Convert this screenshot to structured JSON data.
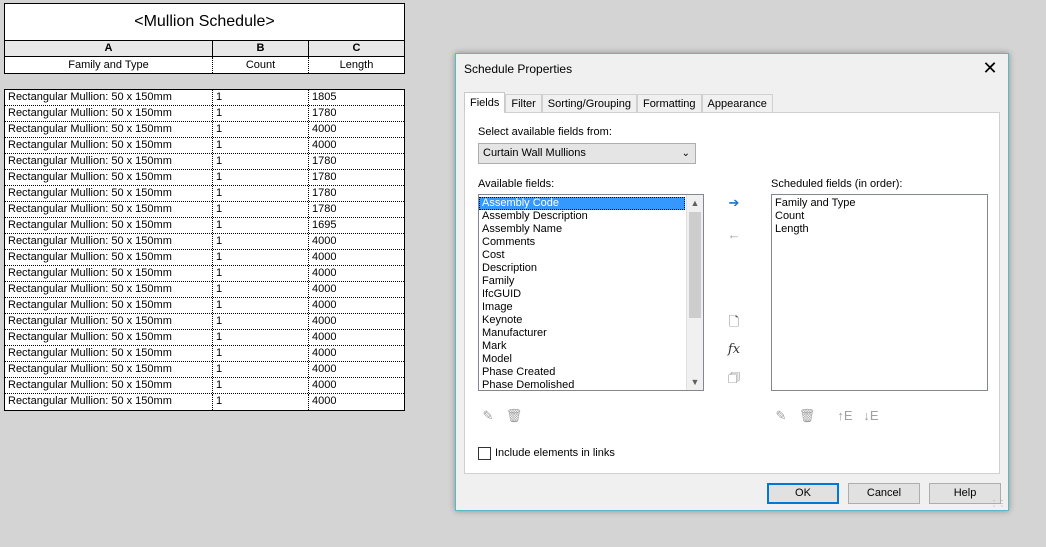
{
  "schedule": {
    "title": "<Mullion Schedule>",
    "column_letters": [
      "A",
      "B",
      "C"
    ],
    "column_headers": [
      "Family and Type",
      "Count",
      "Length"
    ],
    "rows": [
      [
        "Rectangular Mullion: 50 x 150mm",
        "1",
        "1805"
      ],
      [
        "Rectangular Mullion: 50 x 150mm",
        "1",
        "1780"
      ],
      [
        "Rectangular Mullion: 50 x 150mm",
        "1",
        "4000"
      ],
      [
        "Rectangular Mullion: 50 x 150mm",
        "1",
        "4000"
      ],
      [
        "Rectangular Mullion: 50 x 150mm",
        "1",
        "1780"
      ],
      [
        "Rectangular Mullion: 50 x 150mm",
        "1",
        "1780"
      ],
      [
        "Rectangular Mullion: 50 x 150mm",
        "1",
        "1780"
      ],
      [
        "Rectangular Mullion: 50 x 150mm",
        "1",
        "1780"
      ],
      [
        "Rectangular Mullion: 50 x 150mm",
        "1",
        "1695"
      ],
      [
        "Rectangular Mullion: 50 x 150mm",
        "1",
        "4000"
      ],
      [
        "Rectangular Mullion: 50 x 150mm",
        "1",
        "4000"
      ],
      [
        "Rectangular Mullion: 50 x 150mm",
        "1",
        "4000"
      ],
      [
        "Rectangular Mullion: 50 x 150mm",
        "1",
        "4000"
      ],
      [
        "Rectangular Mullion: 50 x 150mm",
        "1",
        "4000"
      ],
      [
        "Rectangular Mullion: 50 x 150mm",
        "1",
        "4000"
      ],
      [
        "Rectangular Mullion: 50 x 150mm",
        "1",
        "4000"
      ],
      [
        "Rectangular Mullion: 50 x 150mm",
        "1",
        "4000"
      ],
      [
        "Rectangular Mullion: 50 x 150mm",
        "1",
        "4000"
      ],
      [
        "Rectangular Mullion: 50 x 150mm",
        "1",
        "4000"
      ],
      [
        "Rectangular Mullion: 50 x 150mm",
        "1",
        "4000"
      ]
    ]
  },
  "dialog": {
    "title": "Schedule Properties",
    "close_glyph": "✕",
    "tabs": [
      "Fields",
      "Filter",
      "Sorting/Grouping",
      "Formatting",
      "Appearance"
    ],
    "active_tab": "Fields",
    "select_label": "Select available fields from:",
    "select_value": "Curtain Wall Mullions",
    "available_label": "Available fields:",
    "available_fields": [
      "Assembly Code",
      "Assembly Description",
      "Assembly Name",
      "Comments",
      "Cost",
      "Description",
      "Family",
      "IfcGUID",
      "Image",
      "Keynote",
      "Manufacturer",
      "Mark",
      "Model",
      "Phase Created",
      "Phase Demolished"
    ],
    "available_selected": "Assembly Code",
    "scheduled_label": "Scheduled fields (in order):",
    "scheduled_fields": [
      "Family and Type",
      "Count",
      "Length"
    ],
    "include_links_label": "Include elements in links",
    "include_links_checked": false,
    "buttons": {
      "ok": "OK",
      "cancel": "Cancel",
      "help": "Help"
    },
    "icons": {
      "add": "add-parameter-icon",
      "remove": "remove-parameter-icon",
      "new_param": "new-parameter-icon",
      "calculated": "calculated-value-icon",
      "combine": "combine-parameters-icon",
      "edit": "edit-parameter-icon",
      "delete": "delete-parameter-icon",
      "move_up": "move-up-icon",
      "move_down": "move-down-icon"
    },
    "fx_glyph": "fx",
    "accent": "#3399ff",
    "border_color": "#58b9c9"
  }
}
